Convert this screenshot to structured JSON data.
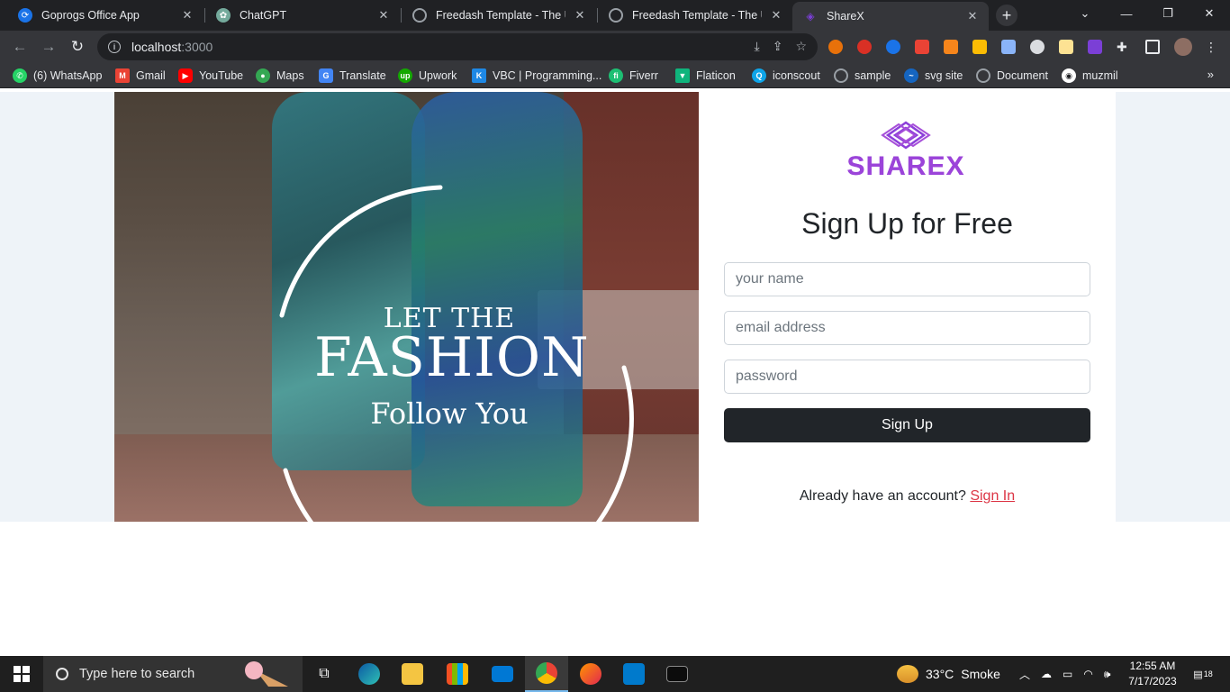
{
  "browser": {
    "tabs": [
      {
        "title": "Goprogs Office App",
        "color": "#1a73e8"
      },
      {
        "title": "ChatGPT",
        "color": "#74aa9c"
      },
      {
        "title": "Freedash Template - The Ultim",
        "color": "#9aa0a6"
      },
      {
        "title": "Freedash Template - The Ultim",
        "color": "#9aa0a6"
      },
      {
        "title": "ShareX",
        "color": "#7b3fd6"
      }
    ],
    "new_tab_label": "+",
    "url_host": "localhost",
    "url_port": ":3000",
    "bookmarks": [
      {
        "label": "(6) WhatsApp",
        "color": "#25d366"
      },
      {
        "label": "Gmail",
        "color": "#ea4335"
      },
      {
        "label": "YouTube",
        "color": "#ff0000"
      },
      {
        "label": "Maps",
        "color": "#34a853"
      },
      {
        "label": "Translate",
        "color": "#4285f4"
      },
      {
        "label": "Upwork",
        "color": "#14a800"
      },
      {
        "label": "VBC | Programming...",
        "color": "#1e88e5"
      },
      {
        "label": "Fiverr",
        "color": "#1dbf73"
      },
      {
        "label": "Flaticon",
        "color": "#0fb47c"
      },
      {
        "label": "iconscout",
        "color": "#0ea5e9"
      },
      {
        "label": "sample",
        "color": "#9aa0a6"
      },
      {
        "label": "svg site",
        "color": "#1565c0"
      },
      {
        "label": "Document",
        "color": "#9aa0a6"
      },
      {
        "label": "muzmil",
        "color": "#ffffff"
      }
    ],
    "bookmarks_more": "»"
  },
  "hero": {
    "line1": "LET THE",
    "line2": "FASHION",
    "line3": "Follow You"
  },
  "form": {
    "brand_name": "SHAREX",
    "brand_color": "#9b44d9",
    "heading": "Sign Up for Free",
    "name_placeholder": "your name",
    "email_placeholder": "email address",
    "password_placeholder": "password",
    "submit_label": "Sign Up",
    "signin_prompt": "Already have an account?",
    "signin_link": "Sign In",
    "link_color": "#dc3545"
  },
  "taskbar": {
    "search_placeholder": "Type here to search",
    "temperature": "33°C",
    "weather": "Smoke",
    "time": "12:55 AM",
    "date": "7/17/2023",
    "notifications": "18"
  }
}
